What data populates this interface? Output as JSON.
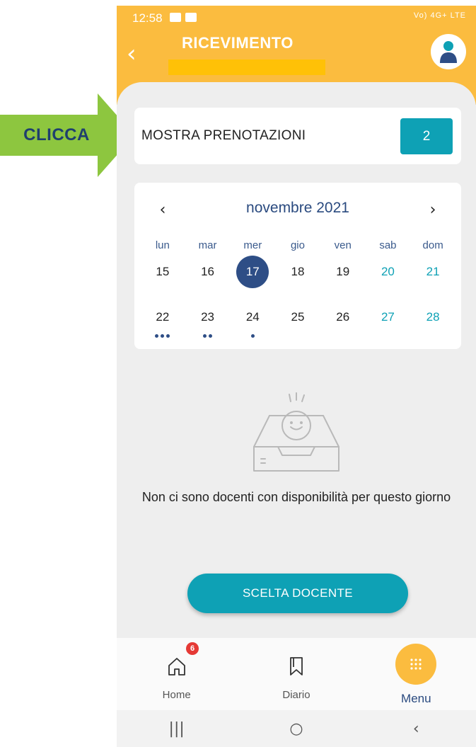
{
  "instruction": {
    "label": "CLICCA",
    "arrow_color": "#8dc63f"
  },
  "status_bar": {
    "time": "12:58",
    "right_indicators": "Vo) 4G+ LTE"
  },
  "header": {
    "title": "RICEVIMENTO",
    "background": "#fbbc3f"
  },
  "bookings": {
    "label": "MOSTRA PRENOTAZIONI",
    "count": "2"
  },
  "calendar": {
    "month_label": "novembre 2021",
    "weekdays": [
      "lun",
      "mar",
      "mer",
      "gio",
      "ven",
      "sab",
      "dom"
    ],
    "weeks": [
      [
        {
          "day": "15",
          "weekend": false,
          "selected": false,
          "dots": 0
        },
        {
          "day": "16",
          "weekend": false,
          "selected": false,
          "dots": 0
        },
        {
          "day": "17",
          "weekend": false,
          "selected": true,
          "dots": 0
        },
        {
          "day": "18",
          "weekend": false,
          "selected": false,
          "dots": 0
        },
        {
          "day": "19",
          "weekend": false,
          "selected": false,
          "dots": 0
        },
        {
          "day": "20",
          "weekend": true,
          "selected": false,
          "dots": 0
        },
        {
          "day": "21",
          "weekend": true,
          "selected": false,
          "dots": 0
        }
      ],
      [
        {
          "day": "22",
          "weekend": false,
          "selected": false,
          "dots": 3
        },
        {
          "day": "23",
          "weekend": false,
          "selected": false,
          "dots": 2
        },
        {
          "day": "24",
          "weekend": false,
          "selected": false,
          "dots": 1
        },
        {
          "day": "25",
          "weekend": false,
          "selected": false,
          "dots": 0
        },
        {
          "day": "26",
          "weekend": false,
          "selected": false,
          "dots": 0
        },
        {
          "day": "27",
          "weekend": true,
          "selected": false,
          "dots": 0
        },
        {
          "day": "28",
          "weekend": true,
          "selected": false,
          "dots": 0
        }
      ]
    ]
  },
  "empty_state": {
    "message": "Non ci sono docenti con disponibilità per questo giorno",
    "icon": "empty-inbox-icon"
  },
  "teacher_button": {
    "label": "SCELTA DOCENTE"
  },
  "bottom_nav": {
    "items": [
      {
        "label": "Home",
        "icon": "home-icon",
        "badge": "6"
      },
      {
        "label": "Diario",
        "icon": "bookmark-icon"
      },
      {
        "label": "Menu",
        "icon": "menu-grid-icon",
        "active": true
      }
    ]
  },
  "system_nav": {
    "recents": "|||",
    "home": "○",
    "back": "‹"
  },
  "colors": {
    "accent": "#0ea1b5",
    "primary": "#2e4e86",
    "header": "#fbbc3f",
    "badge": "#e53935"
  }
}
